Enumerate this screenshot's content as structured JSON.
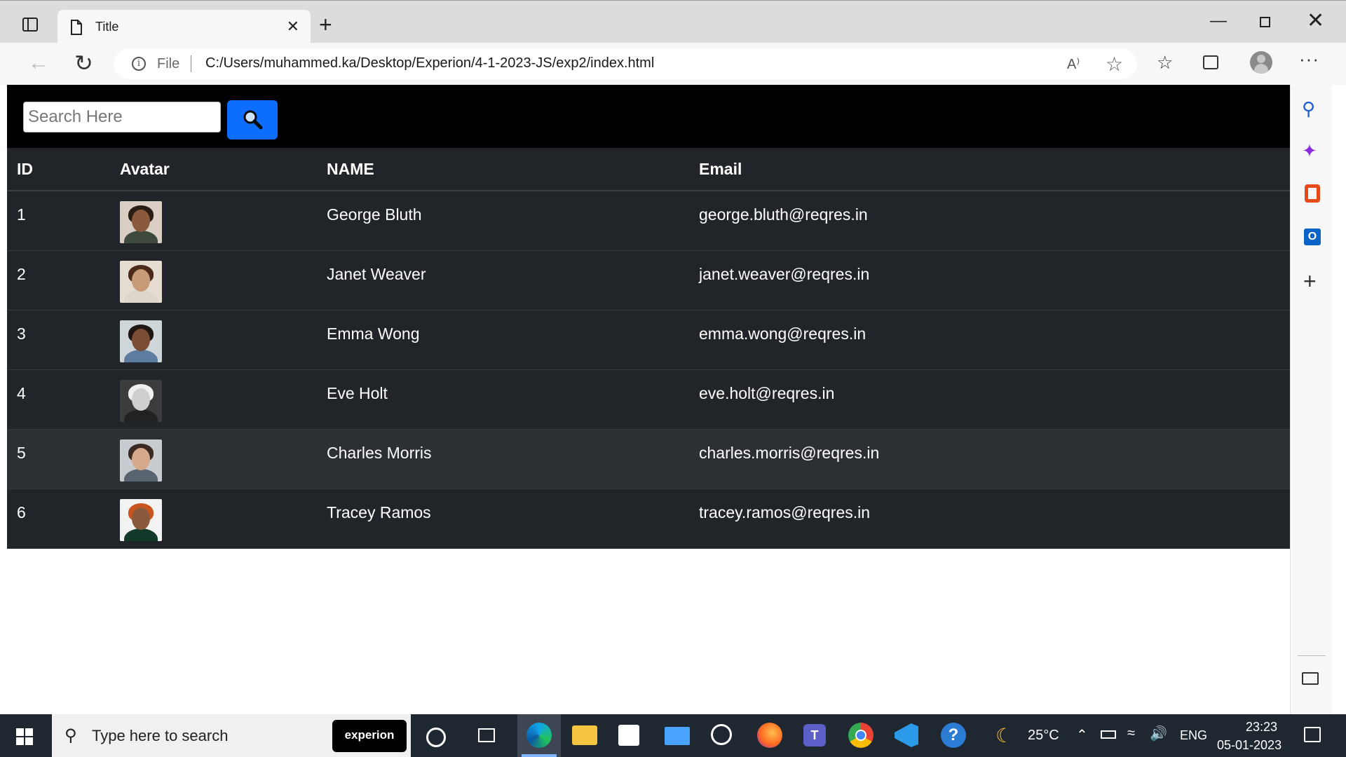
{
  "browser": {
    "tab_title": "Title",
    "new_tab_glyph": "+",
    "close_glyph": "✕",
    "minimize_glyph": "—",
    "window_close_glyph": "✕",
    "address_scheme": "File",
    "address_url": "C:/Users/muhammed.ka/Desktop/Experion/4-1-2023-JS/exp2/index.html",
    "read_aloud_glyph": "A⁾",
    "more_glyph": "···"
  },
  "search": {
    "placeholder": "Search Here",
    "button_icon": "search-icon"
  },
  "table": {
    "headers": [
      "ID",
      "Avatar",
      "NAME",
      "Email"
    ],
    "rows": [
      {
        "id": "1",
        "name": "George Bluth",
        "email": "george.bluth@reqres.in",
        "avatar_colors": {
          "bg": "#d9cfc4",
          "skin": "#8a5a3c",
          "hair": "#2a1d16",
          "body": "#3e4a3c"
        }
      },
      {
        "id": "2",
        "name": "Janet Weaver",
        "email": "janet.weaver@reqres.in",
        "avatar_colors": {
          "bg": "#e6ddd2",
          "skin": "#c79a78",
          "hair": "#4a2a1a",
          "body": "#dcd6cc"
        }
      },
      {
        "id": "3",
        "name": "Emma Wong",
        "email": "emma.wong@reqres.in",
        "avatar_colors": {
          "bg": "#cfd6d9",
          "skin": "#7a4d34",
          "hair": "#1e1612",
          "body": "#5c7da0"
        }
      },
      {
        "id": "4",
        "name": "Eve Holt",
        "email": "eve.holt@reqres.in",
        "avatar_colors": {
          "bg": "#3c3c3c",
          "skin": "#cfcfcf",
          "hair": "#efefef",
          "body": "#222222"
        }
      },
      {
        "id": "5",
        "name": "Charles Morris",
        "email": "charles.morris@reqres.in",
        "avatar_colors": {
          "bg": "#c8ccd0",
          "skin": "#d6a98a",
          "hair": "#3a2a22",
          "body": "#5a6470"
        }
      },
      {
        "id": "6",
        "name": "Tracey Ramos",
        "email": "tracey.ramos@reqres.in",
        "avatar_colors": {
          "bg": "#f2f2f2",
          "skin": "#8a5a3c",
          "hair": "#c9541f",
          "body": "#123a2a"
        }
      }
    ],
    "highlighted_row_index": 4
  },
  "sidebar": {
    "items": [
      "search-icon",
      "copilot-icon",
      "office-icon",
      "outlook-icon",
      "add-icon",
      "hide-sidebar-icon"
    ],
    "outlook_letter": "O"
  },
  "taskbar": {
    "search_placeholder": "Type here to search",
    "search_logo_text": "experion",
    "teams_letter": "T",
    "help_glyph": "?",
    "temperature": "25°C",
    "language": "ENG",
    "time": "23:23",
    "date": "05-01-2023"
  },
  "colors": {
    "page_header_bg": "#000000",
    "table_bg": "#212529",
    "search_button": "#0d6efd",
    "taskbar_bg": "#1f2731"
  }
}
